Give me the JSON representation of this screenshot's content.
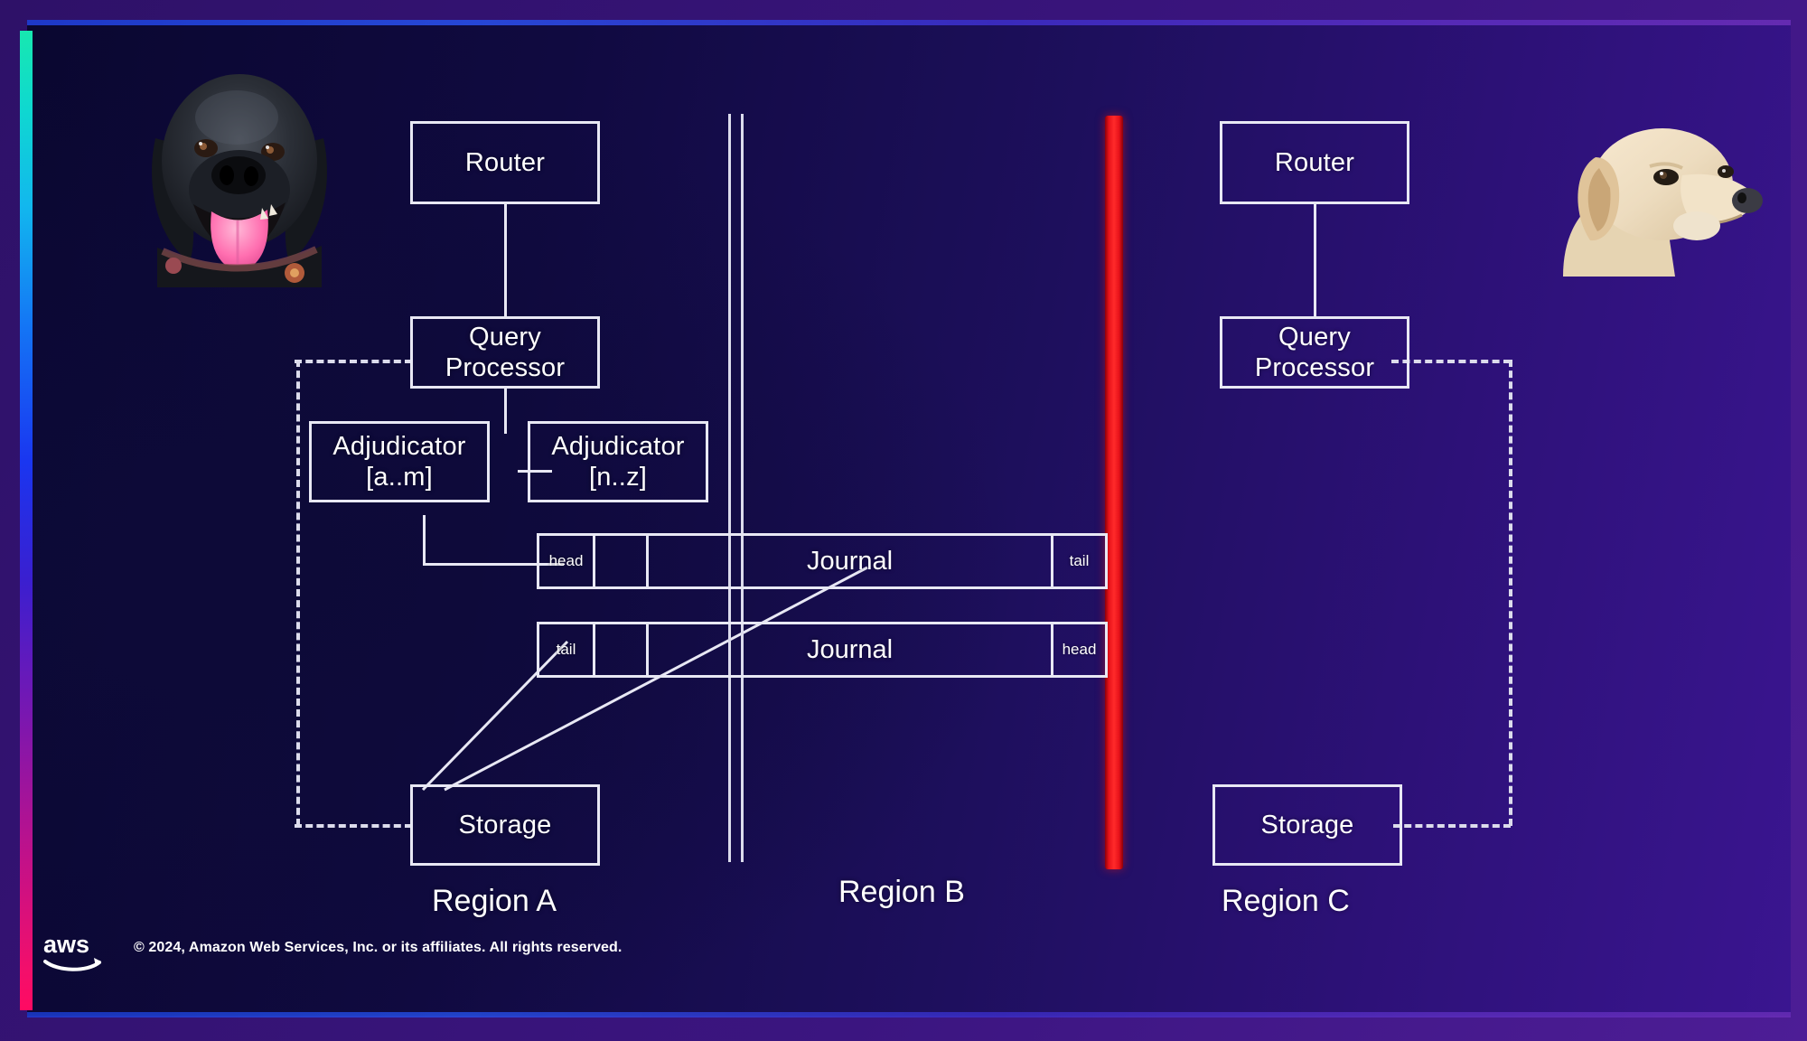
{
  "slide": {
    "title_absent": "",
    "accent_colors": {
      "rail_top": "#17e8b0",
      "rail_mid": "#1a36f0",
      "rail_bottom": "#ff0a62",
      "divider_white": "#dcdcec",
      "red_bar": "#e8121a",
      "box_stroke": "#e8e8f4",
      "text": "#ffffff",
      "bg_left": "#0a0730",
      "bg_right": "#3a1590"
    }
  },
  "regions": [
    {
      "id": "a",
      "label": "Region A"
    },
    {
      "id": "b",
      "label": "Region B"
    },
    {
      "id": "c",
      "label": "Region C"
    }
  ],
  "region_a": {
    "router": "Router",
    "query_processor_line1": "Query",
    "query_processor_line2": "Processor",
    "adjudicator_left_line1": "Adjudicator",
    "adjudicator_left_line2": "[a..m]",
    "adjudicator_right_line1": "Adjudicator",
    "adjudicator_right_line2": "[n..z]",
    "storage": "Storage",
    "journal_top": {
      "name": "Journal",
      "left_cell": "head",
      "right_cell": "tail"
    },
    "journal_bottom": {
      "name": "Journal",
      "left_cell": "tail",
      "right_cell": "head"
    }
  },
  "region_c": {
    "router": "Router",
    "query_processor_line1": "Query",
    "query_processor_line2": "Processor",
    "storage": "Storage"
  },
  "photos": [
    {
      "name": "black-labrador-photo",
      "alt": "Black labrador dog with pink tongue"
    },
    {
      "name": "yellow-labrador-photo",
      "alt": "Yellow labrador dog head"
    }
  ],
  "footer": {
    "logo": "aws-logo",
    "copyright": "© 2024, Amazon Web Services, Inc. or its affiliates. All rights reserved."
  }
}
